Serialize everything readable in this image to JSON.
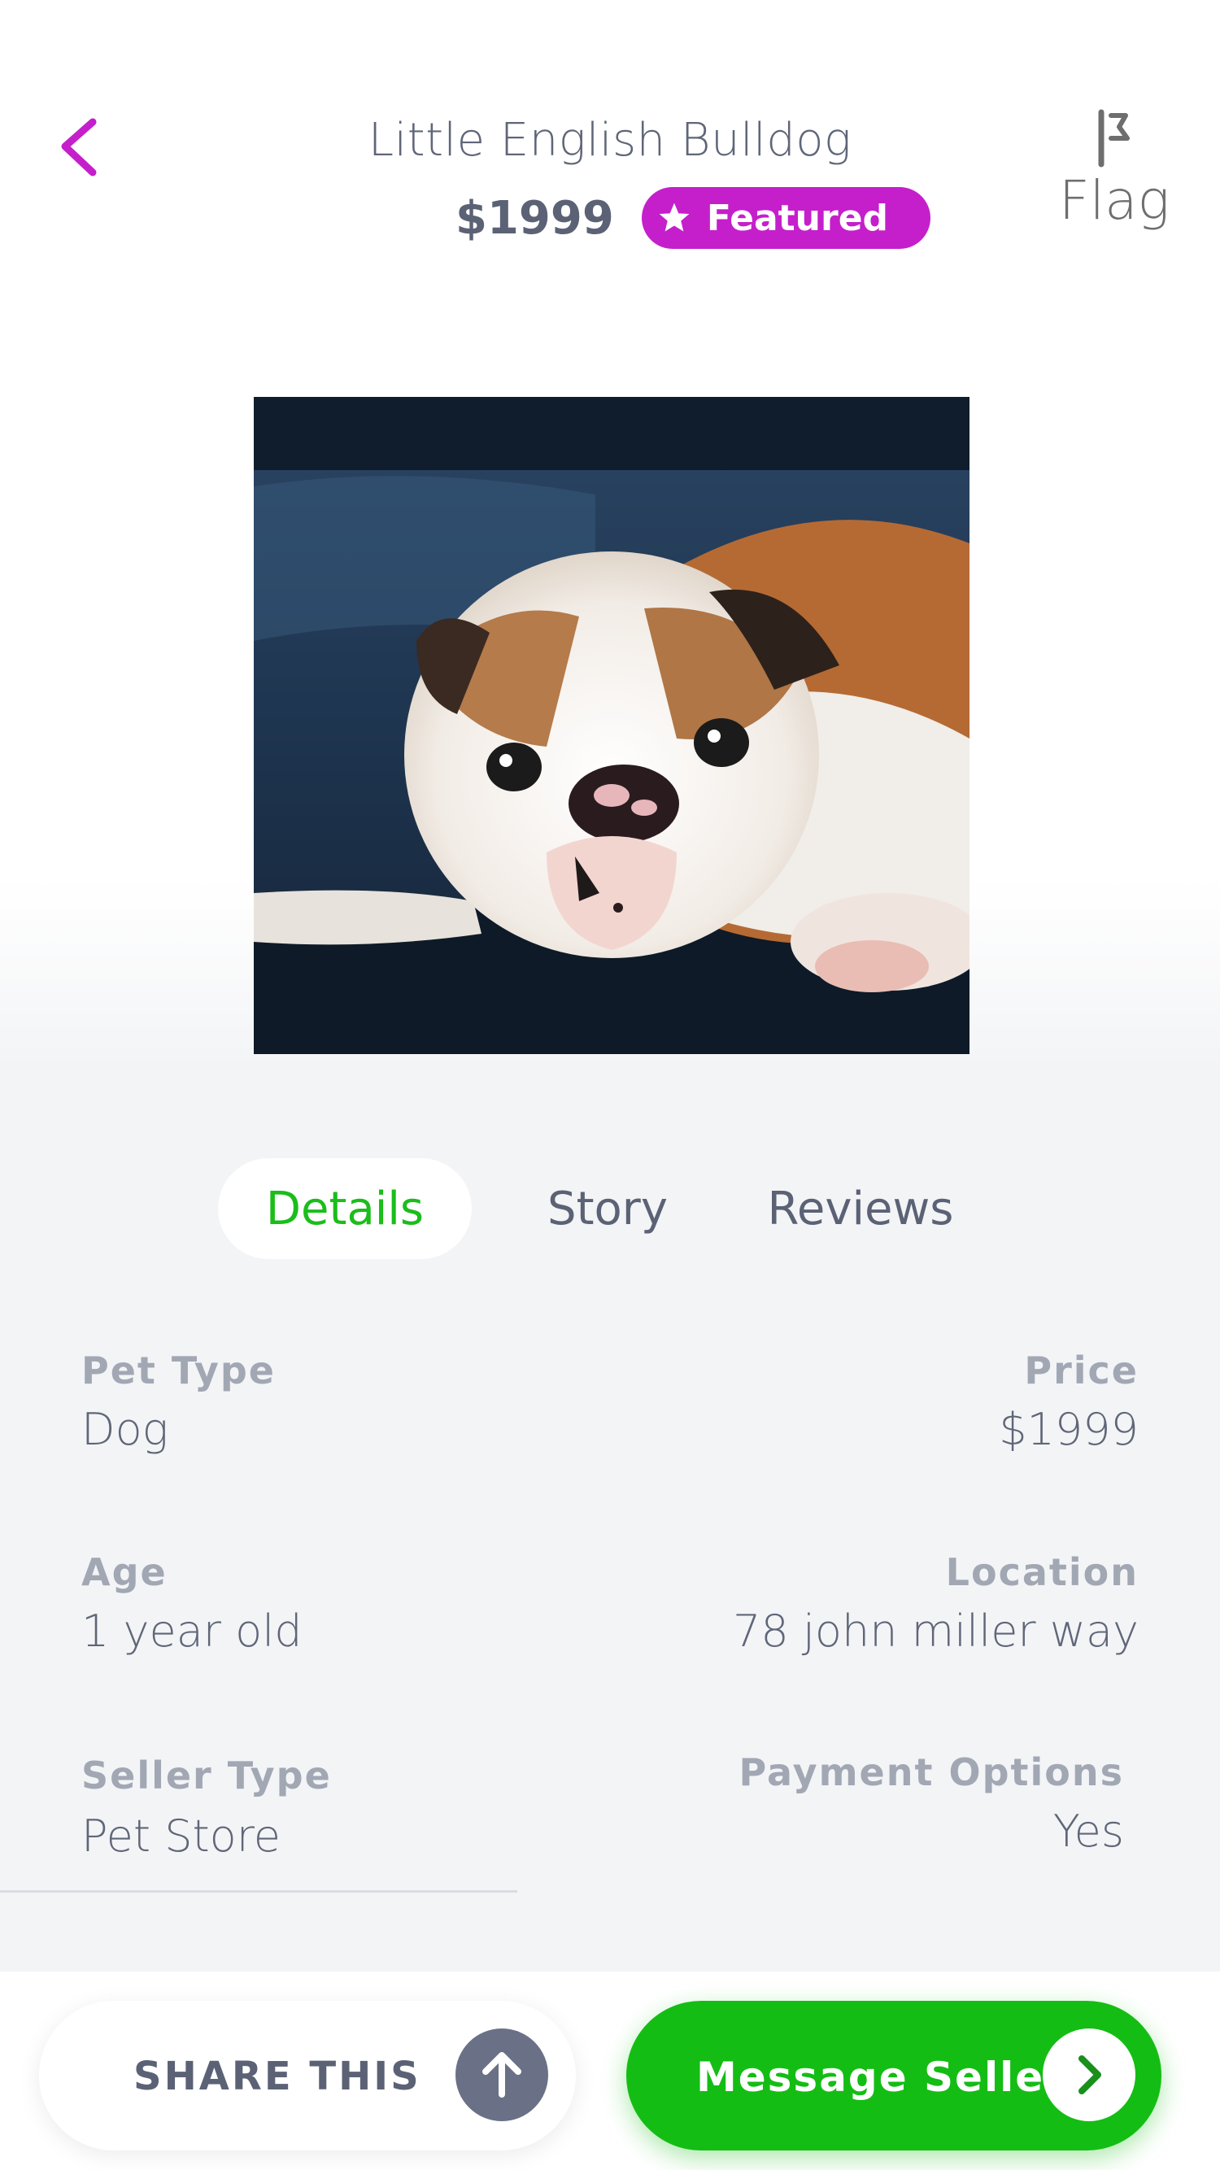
{
  "header": {
    "title": "Little English Bulldog",
    "price": "$1999",
    "badge_label": "Featured",
    "flag_label": "Flag"
  },
  "photo": {
    "alt": "Bulldog puppy lying on a dark leather couch"
  },
  "tabs": [
    {
      "label": "Details",
      "active": true
    },
    {
      "label": "Story",
      "active": false
    },
    {
      "label": "Reviews",
      "active": false
    }
  ],
  "details": {
    "pet_type": {
      "label": "Pet Type",
      "value": "Dog"
    },
    "price": {
      "label": "Price",
      "value": "$1999"
    },
    "age": {
      "label": "Age",
      "value": "1 year old"
    },
    "location": {
      "label": "Location",
      "value": "78 john miller way"
    },
    "seller_type": {
      "label": "Seller Type",
      "value": "Pet Store"
    },
    "payment_options": {
      "label": "Payment Options",
      "value": "Yes"
    }
  },
  "actions": {
    "share_label": "SHARE THIS",
    "message_label": "Message Seller"
  },
  "colors": {
    "accent_magenta": "#c51fcc",
    "accent_green": "#14bd14",
    "text": "#5f6678",
    "label": "#a2a7b4"
  },
  "icons": {
    "back": "chevron-left-icon",
    "flag": "flag-icon",
    "badge": "star-icon",
    "share": "arrow-up-icon",
    "message": "chevron-right-icon"
  }
}
